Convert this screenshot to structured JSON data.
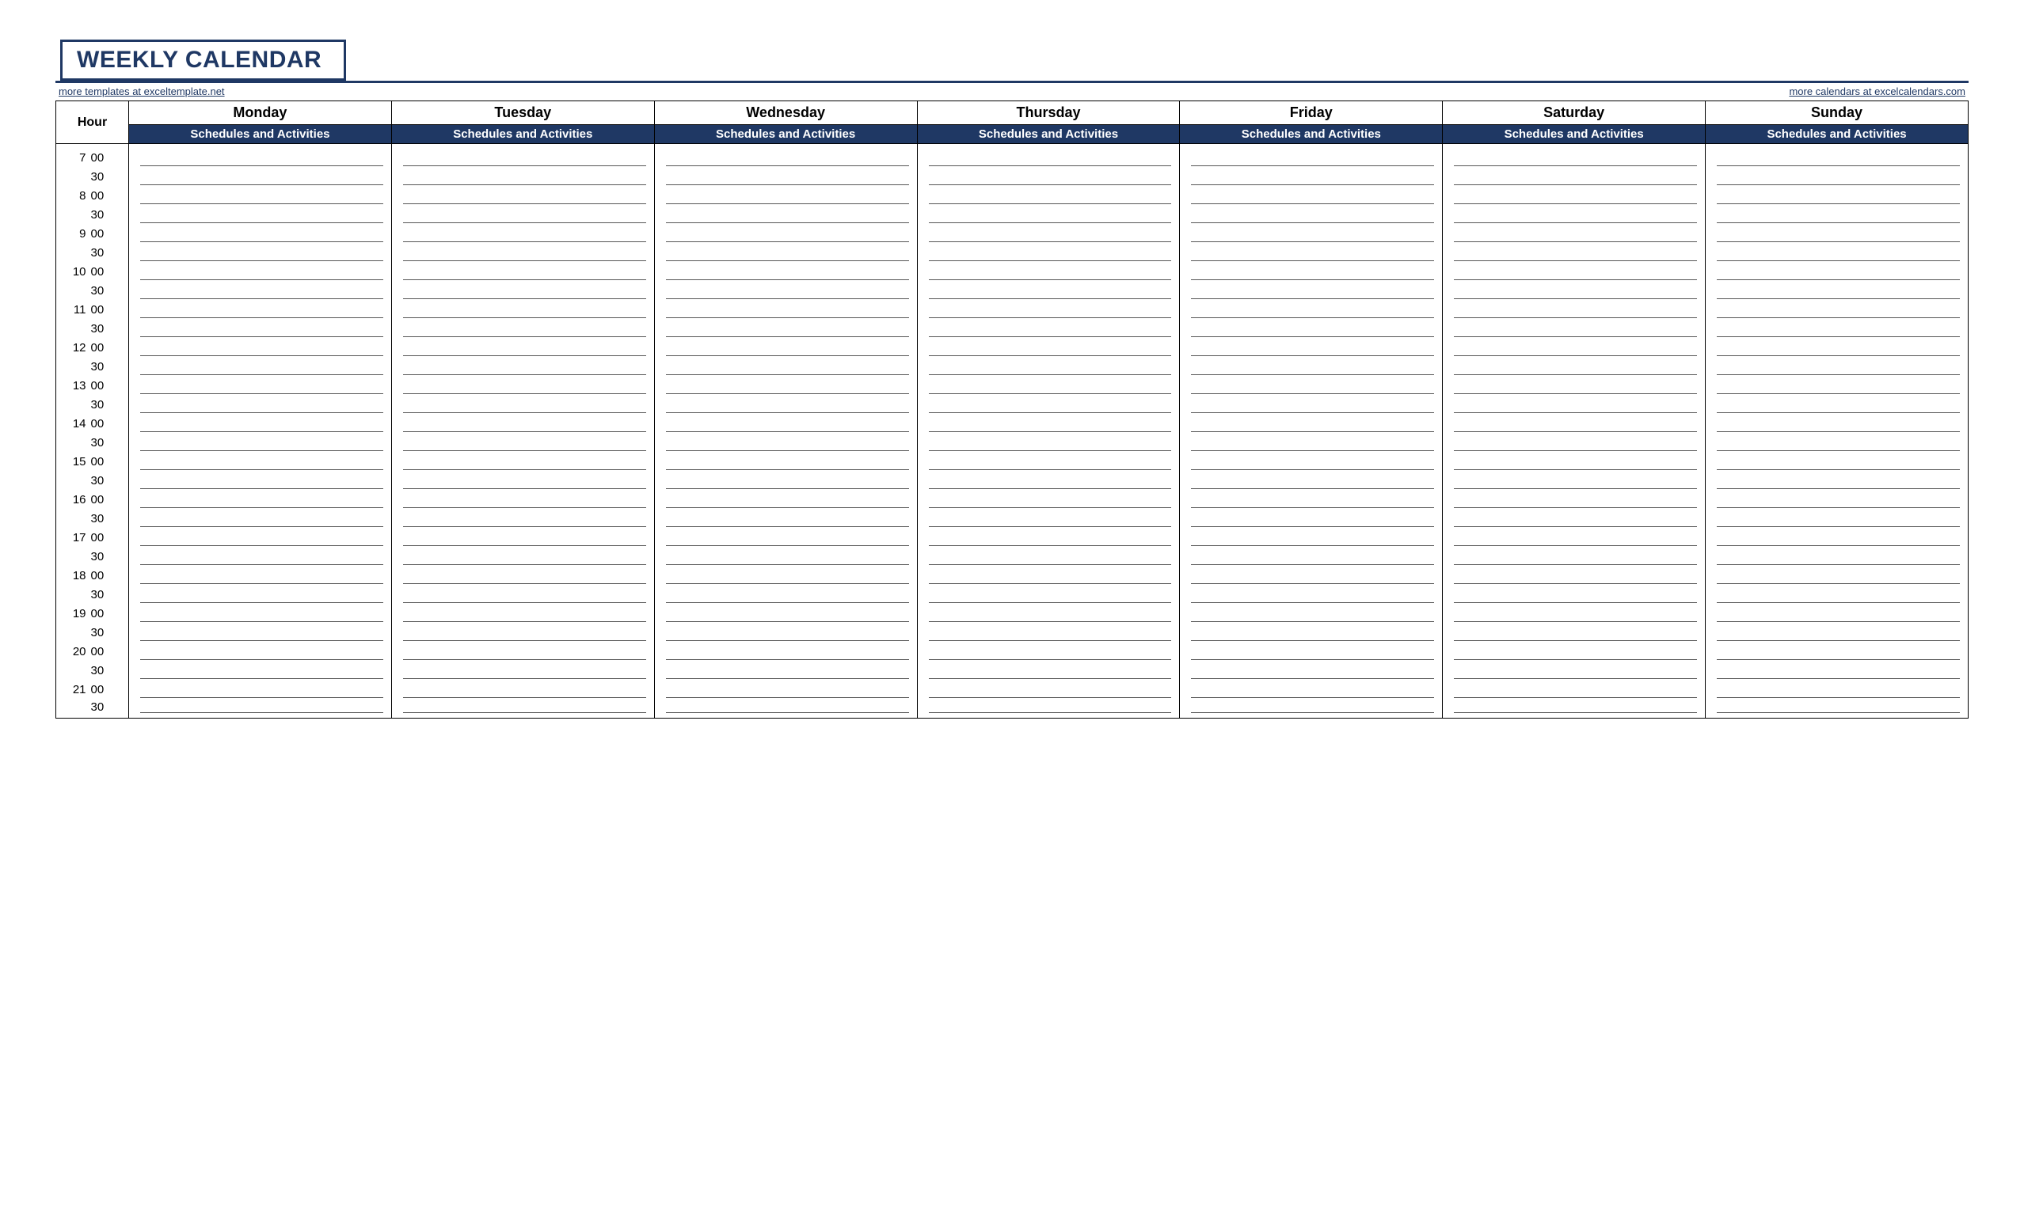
{
  "title": "WEEKLY CALENDAR",
  "link_left": "more templates at exceltemplate.net",
  "link_right": "more calendars at excelcalendars.com",
  "hour_header": "Hour",
  "sub_header": "Schedules and Activities",
  "days": [
    "Monday",
    "Tuesday",
    "Wednesday",
    "Thursday",
    "Friday",
    "Saturday",
    "Sunday"
  ],
  "time_slots": [
    {
      "hour": "7",
      "min": "00"
    },
    {
      "hour": "",
      "min": "30"
    },
    {
      "hour": "8",
      "min": "00"
    },
    {
      "hour": "",
      "min": "30"
    },
    {
      "hour": "9",
      "min": "00"
    },
    {
      "hour": "",
      "min": "30"
    },
    {
      "hour": "10",
      "min": "00"
    },
    {
      "hour": "",
      "min": "30"
    },
    {
      "hour": "11",
      "min": "00"
    },
    {
      "hour": "",
      "min": "30"
    },
    {
      "hour": "12",
      "min": "00"
    },
    {
      "hour": "",
      "min": "30"
    },
    {
      "hour": "13",
      "min": "00"
    },
    {
      "hour": "",
      "min": "30"
    },
    {
      "hour": "14",
      "min": "00"
    },
    {
      "hour": "",
      "min": "30"
    },
    {
      "hour": "15",
      "min": "00"
    },
    {
      "hour": "",
      "min": "30"
    },
    {
      "hour": "16",
      "min": "00"
    },
    {
      "hour": "",
      "min": "30"
    },
    {
      "hour": "17",
      "min": "00"
    },
    {
      "hour": "",
      "min": "30"
    },
    {
      "hour": "18",
      "min": "00"
    },
    {
      "hour": "",
      "min": "30"
    },
    {
      "hour": "19",
      "min": "00"
    },
    {
      "hour": "",
      "min": "30"
    },
    {
      "hour": "20",
      "min": "00"
    },
    {
      "hour": "",
      "min": "30"
    },
    {
      "hour": "21",
      "min": "00"
    },
    {
      "hour": "",
      "min": "30"
    }
  ]
}
